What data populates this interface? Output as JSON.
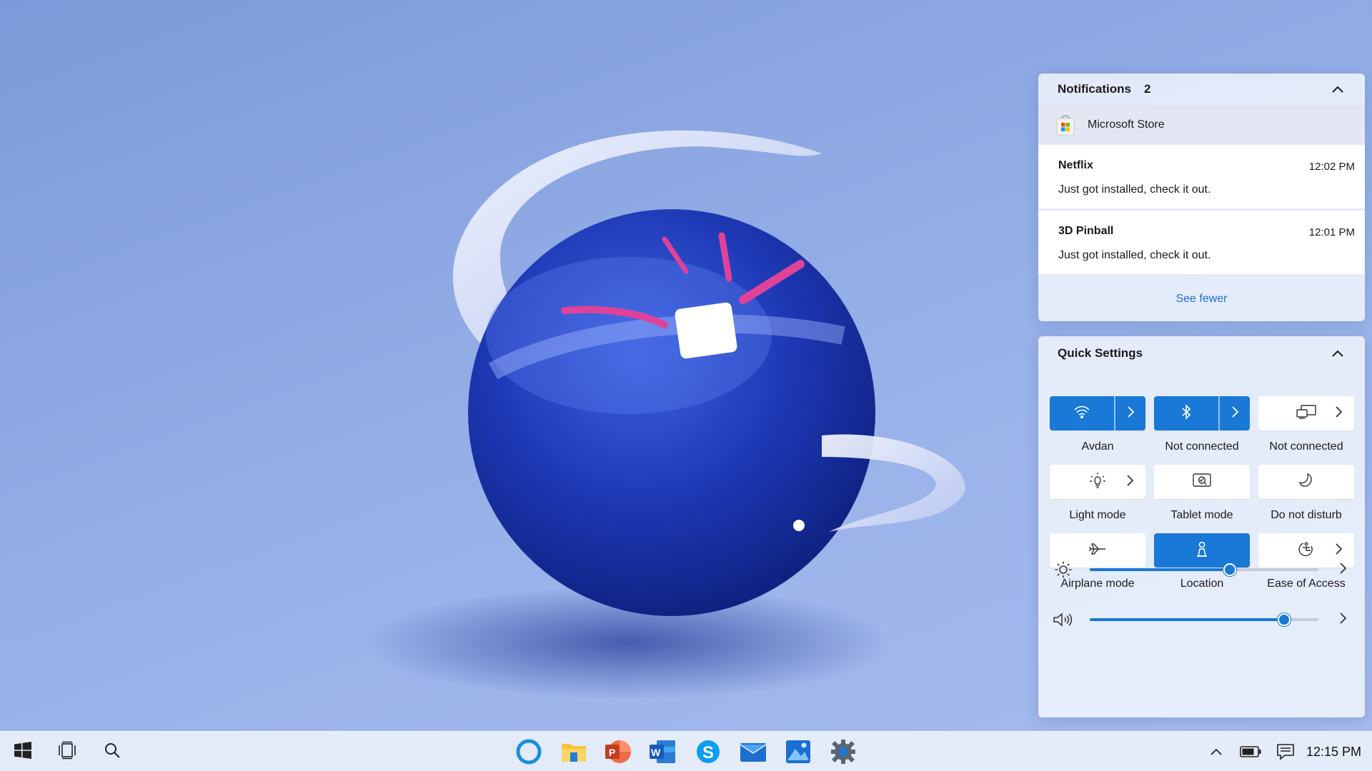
{
  "notifications": {
    "title": "Notifications",
    "count": "2",
    "collapse_icon": "chevron-up-icon",
    "app": {
      "name": "Microsoft Store",
      "icon": "microsoft-store-icon"
    },
    "items": [
      {
        "title": "Netflix",
        "time": "12:02 PM",
        "body": "Just got installed, check it out."
      },
      {
        "title": "3D Pinball",
        "time": "12:01 PM",
        "body": "Just got installed, check it out."
      }
    ],
    "see_fewer": "See fewer"
  },
  "quick_settings": {
    "title": "Quick Settings",
    "collapse_icon": "chevron-up-icon",
    "tiles": [
      {
        "label": "Avdan",
        "icon": "wifi-icon",
        "active": true,
        "has_arrow": true
      },
      {
        "label": "Not connected",
        "icon": "bluetooth-icon",
        "active": true,
        "has_arrow": true
      },
      {
        "label": "Not connected",
        "icon": "project-icon",
        "active": false,
        "has_arrow": true
      },
      {
        "label": "Light mode",
        "icon": "light-bulb-icon",
        "active": false,
        "has_arrow": true
      },
      {
        "label": "Tablet mode",
        "icon": "tablet-mode-icon",
        "active": false,
        "has_arrow": false
      },
      {
        "label": "Do not disturb",
        "icon": "moon-icon",
        "active": false,
        "has_arrow": false
      },
      {
        "label": "Airplane mode",
        "icon": "airplane-icon",
        "active": false,
        "has_arrow": false
      },
      {
        "label": "Location",
        "icon": "location-icon",
        "active": true,
        "has_arrow": false
      },
      {
        "label": "Ease of Access",
        "icon": "ease-of-access-icon",
        "active": false,
        "has_arrow": true
      }
    ],
    "brightness": {
      "icon": "brightness-icon",
      "level": 0.61
    },
    "volume": {
      "icon": "volume-icon",
      "level": 0.85
    }
  },
  "taskbar": {
    "left": [
      "start-icon",
      "task-view-icon",
      "search-icon"
    ],
    "apps": [
      "cortana-icon",
      "file-explorer-icon",
      "powerpoint-icon",
      "word-icon",
      "skype-icon",
      "mail-icon",
      "photos-icon",
      "settings-icon"
    ],
    "tray": [
      "show-hidden-icons-icon",
      "battery-icon",
      "action-center-icon"
    ],
    "clock": "12:15 PM"
  },
  "colors": {
    "accent": "#1a78d6",
    "link": "#1f6fd1",
    "wallpaper_sphere": "#1e3fb8",
    "wallpaper_accent": "#e0429a"
  }
}
